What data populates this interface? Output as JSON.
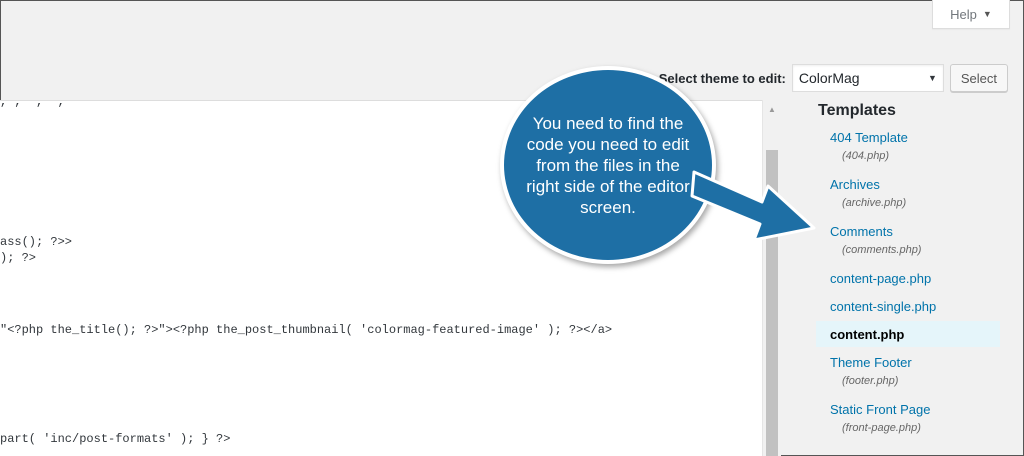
{
  "help": {
    "label": "Help",
    "icon": "caret-down-icon"
  },
  "theme_select": {
    "label": "Select theme to edit:",
    "selected": "ColorMag",
    "button": "Select"
  },
  "editor": {
    "lines": [
      "ass(); ?>>",
      "); ?>",
      "\"<?php the_title(); ?>\"><?php the_post_thumbnail( 'colormag-featured-image' ); ?></a>",
      "part( 'inc/post-formats' ); } ?>"
    ]
  },
  "templates": {
    "heading": "Templates",
    "items": [
      {
        "label": "404 Template",
        "file": "(404.php)"
      },
      {
        "label": "Archives",
        "file": "(archive.php)"
      },
      {
        "label": "Comments",
        "file": "(comments.php)"
      },
      {
        "label": "content-page.php"
      },
      {
        "label": "content-single.php"
      },
      {
        "label": "content.php",
        "current": true
      },
      {
        "label": "Theme Footer",
        "file": "(footer.php)"
      },
      {
        "label": "Static Front Page",
        "file": "(front-page.php)"
      }
    ]
  },
  "callout": {
    "text": "You need to find the code you need to edit from the files in the right side of the editor screen."
  },
  "colors": {
    "link": "#0073aa",
    "callout": "#1e6fa5"
  }
}
